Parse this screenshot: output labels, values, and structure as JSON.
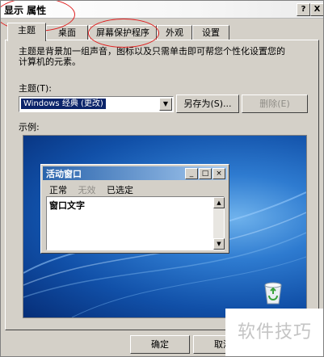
{
  "window": {
    "title": "显示 属性",
    "help_glyph": "?",
    "close_glyph": "X"
  },
  "tabs": [
    {
      "label": "主题"
    },
    {
      "label": "桌面"
    },
    {
      "label": "屏幕保护程序"
    },
    {
      "label": "外观"
    },
    {
      "label": "设置"
    }
  ],
  "themes_tab": {
    "description": "主题是背景加一组声音，图标以及只需单击即可帮您个性化设置您的计算机的元素。",
    "theme_label": "主题(T):",
    "theme_value": "Windows 经典 (更改)",
    "save_as_label": "另存为(S)...",
    "delete_label": "删除(E)",
    "sample_label": "示例:"
  },
  "sample_window": {
    "title": "活动窗口",
    "menu": [
      "正常",
      "无效",
      "已选定"
    ],
    "body_text": "窗口文字"
  },
  "footer": {
    "ok_label": "确定",
    "cancel_label": "取消"
  },
  "watermark": "软件技巧",
  "colors": {
    "window_face": "#d4d0c8",
    "selection": "#0a246a",
    "annotation": "#e02020",
    "desktop_blue": "#1150a8"
  }
}
